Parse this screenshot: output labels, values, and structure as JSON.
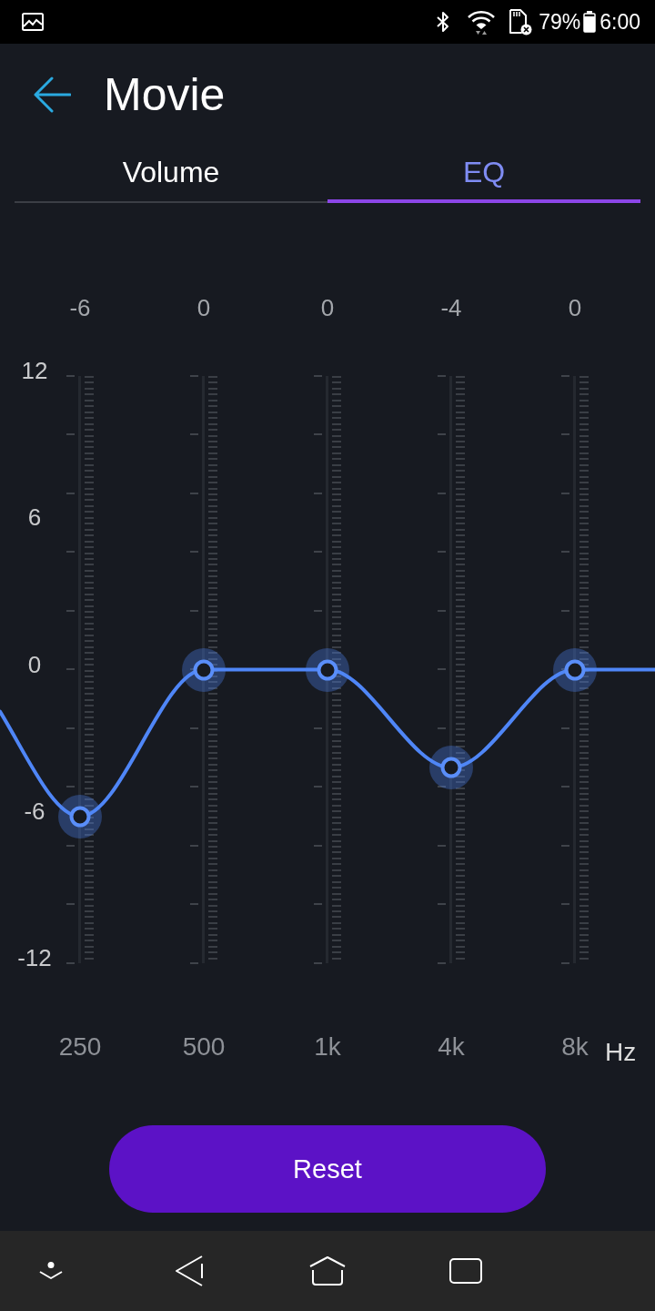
{
  "status_bar": {
    "battery_percent": "79%",
    "time": "6:00"
  },
  "header": {
    "title": "Movie"
  },
  "tabs": [
    {
      "label": "Volume",
      "selected": false
    },
    {
      "label": "EQ",
      "selected": true
    }
  ],
  "equalizer": {
    "scale_labels": [
      "12",
      "6",
      "0",
      "-6",
      "-12"
    ],
    "bands": [
      {
        "reading": "-6",
        "level": 0.25,
        "frequency": "250"
      },
      {
        "reading": "0",
        "level": 0.5,
        "frequency": "500"
      },
      {
        "reading": "0",
        "level": 0.5,
        "frequency": "1k"
      },
      {
        "reading": "-4",
        "level": 0.333,
        "frequency": "4k"
      },
      {
        "reading": "0",
        "level": 0.5,
        "frequency": "8k"
      }
    ],
    "unit": "Hz"
  },
  "reset_button": {
    "label": "Reset"
  }
}
